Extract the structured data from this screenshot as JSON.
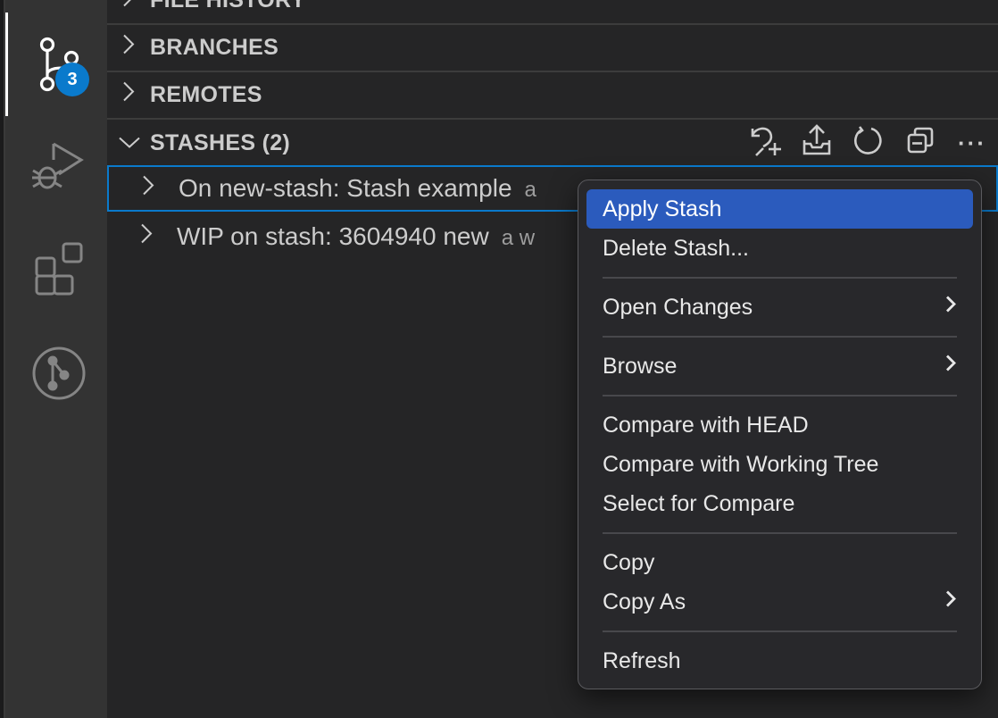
{
  "activity_bar": {
    "items": [
      {
        "name": "source-control",
        "icon": "source-control-icon",
        "active": true,
        "badge": "3"
      },
      {
        "name": "run-and-debug",
        "icon": "debug-alt-icon",
        "active": false
      },
      {
        "name": "extensions",
        "icon": "extensions-icon",
        "active": false
      },
      {
        "name": "gitlens",
        "icon": "gitlens-icon",
        "active": false
      }
    ]
  },
  "sidebar": {
    "sections": [
      {
        "title": "FILE HISTORY",
        "expanded": false
      },
      {
        "title": "BRANCHES",
        "expanded": false
      },
      {
        "title": "REMOTES",
        "expanded": false
      },
      {
        "title": "STASHES (2)",
        "expanded": true
      }
    ],
    "stashes_actions": [
      {
        "name": "stash-changes",
        "icon": "stash-add-icon"
      },
      {
        "name": "apply-stash",
        "icon": "stash-apply-icon"
      },
      {
        "name": "refresh",
        "icon": "refresh-icon"
      },
      {
        "name": "collapse-all",
        "icon": "collapse-all-icon"
      },
      {
        "name": "more-actions",
        "icon": "ellipsis-icon",
        "glyph": "···"
      }
    ],
    "stashes": [
      {
        "label": "On new-stash: Stash example",
        "description": "a",
        "selected": true
      },
      {
        "label": "WIP on stash: 3604940 new",
        "description": "a w",
        "selected": false
      }
    ]
  },
  "context_menu": {
    "items": [
      {
        "label": "Apply Stash",
        "highlighted": true
      },
      {
        "label": "Delete Stash..."
      },
      {
        "separator": true
      },
      {
        "label": "Open Changes",
        "submenu": true
      },
      {
        "separator": true
      },
      {
        "label": "Browse",
        "submenu": true
      },
      {
        "separator": true
      },
      {
        "label": "Compare with HEAD"
      },
      {
        "label": "Compare with Working Tree"
      },
      {
        "label": "Select for Compare"
      },
      {
        "separator": true
      },
      {
        "label": "Copy"
      },
      {
        "label": "Copy As",
        "submenu": true
      },
      {
        "separator": true
      },
      {
        "label": "Refresh"
      }
    ]
  },
  "colors": {
    "accent": "#0a7acc",
    "menu_highlight": "#2b5bbd",
    "activity_bar_bg": "#333333",
    "sidebar_bg": "#252526",
    "menu_bg": "#28282b"
  }
}
